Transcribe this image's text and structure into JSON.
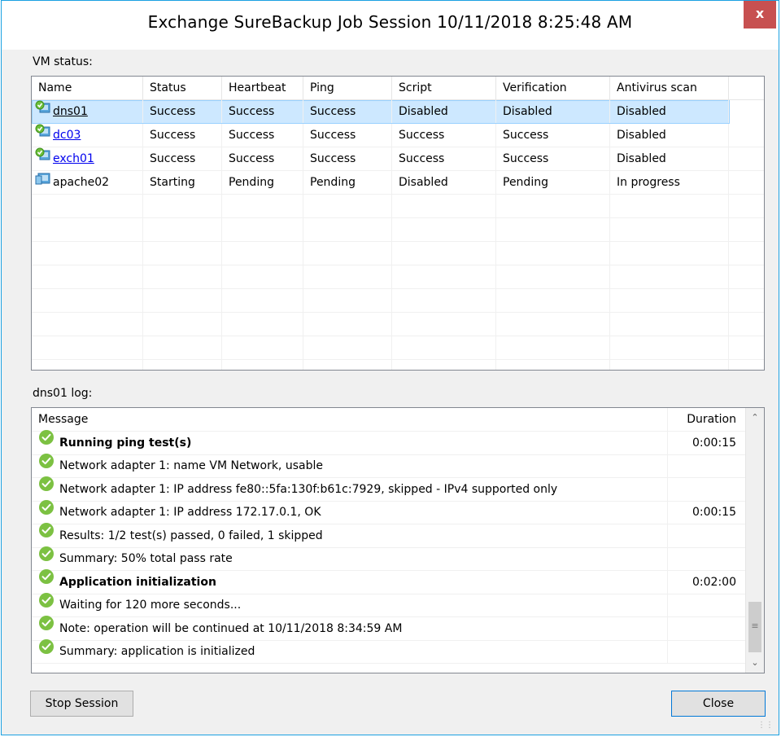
{
  "window": {
    "title": "Exchange SureBackup Job Session 10/11/2018 8:25:48 AM",
    "close_glyph": "x"
  },
  "vm_status": {
    "label": "VM status:",
    "columns": [
      "Name",
      "Status",
      "Heartbeat",
      "Ping",
      "Script",
      "Verification",
      "Antivirus scan"
    ],
    "rows": [
      {
        "name": "dns01",
        "status": "Success",
        "heartbeat": "Success",
        "ping": "Success",
        "script": "Disabled",
        "verification": "Disabled",
        "antivirus": "Disabled",
        "icon": "vm-success-icon",
        "link": true,
        "selected": true
      },
      {
        "name": "dc03",
        "status": "Success",
        "heartbeat": "Success",
        "ping": "Success",
        "script": "Success",
        "verification": "Success",
        "antivirus": "Disabled",
        "icon": "vm-success-icon",
        "link": true,
        "selected": false
      },
      {
        "name": "exch01",
        "status": "Success",
        "heartbeat": "Success",
        "ping": "Success",
        "script": "Success",
        "verification": "Success",
        "antivirus": "Disabled",
        "icon": "vm-success-icon",
        "link": true,
        "selected": false
      },
      {
        "name": "apache02",
        "status": "Starting",
        "heartbeat": "Pending",
        "ping": "Pending",
        "script": "Disabled",
        "verification": "Pending",
        "antivirus": "In progress",
        "icon": "vm-icon",
        "link": false,
        "selected": false
      }
    ]
  },
  "log": {
    "label": "dns01 log:",
    "columns": [
      "Message",
      "Duration"
    ],
    "rows": [
      {
        "message": "Running ping test(s)",
        "duration": "0:00:15",
        "bold": true
      },
      {
        "message": "Network adapter 1: name VM Network, usable",
        "duration": "",
        "bold": false
      },
      {
        "message": "Network adapter 1: IP address fe80::5fa:130f:b61c:7929, skipped - IPv4 supported only",
        "duration": "",
        "bold": false
      },
      {
        "message": "Network adapter 1: IP address 172.17.0.1, OK",
        "duration": "0:00:15",
        "bold": false
      },
      {
        "message": "Results: 1/2 test(s) passed, 0 failed, 1 skipped",
        "duration": "",
        "bold": false
      },
      {
        "message": "Summary: 50% total pass rate",
        "duration": "",
        "bold": false
      },
      {
        "message": "Application initialization",
        "duration": "0:02:00",
        "bold": true
      },
      {
        "message": "Waiting for 120 more seconds...",
        "duration": "",
        "bold": false
      },
      {
        "message": "Note: operation will be continued at 10/11/2018 8:34:59 AM",
        "duration": "",
        "bold": false
      },
      {
        "message": "Summary: application is initialized",
        "duration": "",
        "bold": false
      }
    ]
  },
  "buttons": {
    "stop_session": "Stop Session",
    "close": "Close"
  },
  "colors": {
    "accent": "#1ba1e2",
    "selection": "#cde8ff",
    "success_green": "#7cc142",
    "link": "#0000ee",
    "close_red": "#c75050"
  }
}
